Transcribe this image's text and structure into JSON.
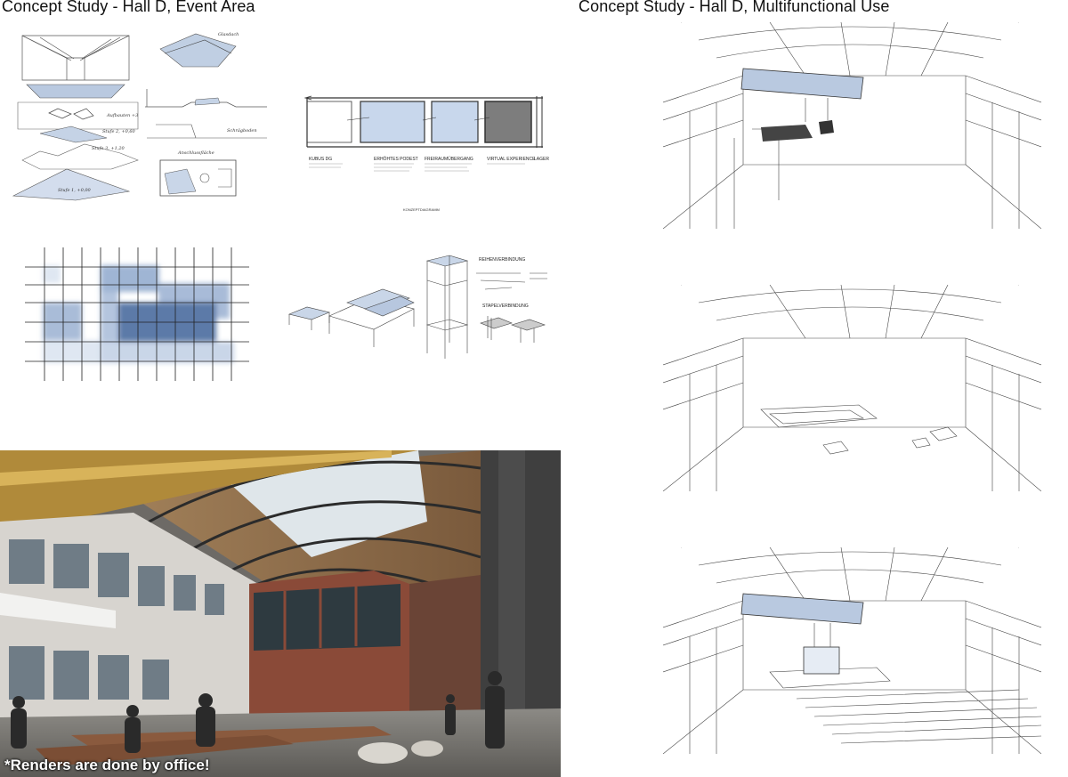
{
  "titles": {
    "left": "Concept Study - Hall D, Event Area",
    "right": "Concept Study - Hall D, Multifunctional Use"
  },
  "render_note": "*Renders are done by office!",
  "concept_diagram": {
    "labels": [
      "KUBUS DG",
      "ERHÖHTES PODEST",
      "FREIRAUMÜBERGANG",
      "VIRTUAL EXPERIENCE",
      "LAGER"
    ],
    "caption": "KONZEPTDIAGRAMM"
  },
  "connections": {
    "row": "REIHENVERBINDUNG",
    "stack": "STAPELVERBINDUNG"
  },
  "sketch_notes": [
    "Stufe 1, +0,00",
    "Stufe 2, +0,60",
    "Stufe 3, +1,20",
    "Aufbauten +3",
    "Glasdach",
    "Schrägboden",
    "Anschlussfläche"
  ],
  "colors": {
    "blue_light": "#c9d6e8",
    "blue_mid": "#9fb5d4",
    "blue_dark": "#6f8cb8",
    "rust": "#8a4a38",
    "dark": "#2a2a2a"
  }
}
